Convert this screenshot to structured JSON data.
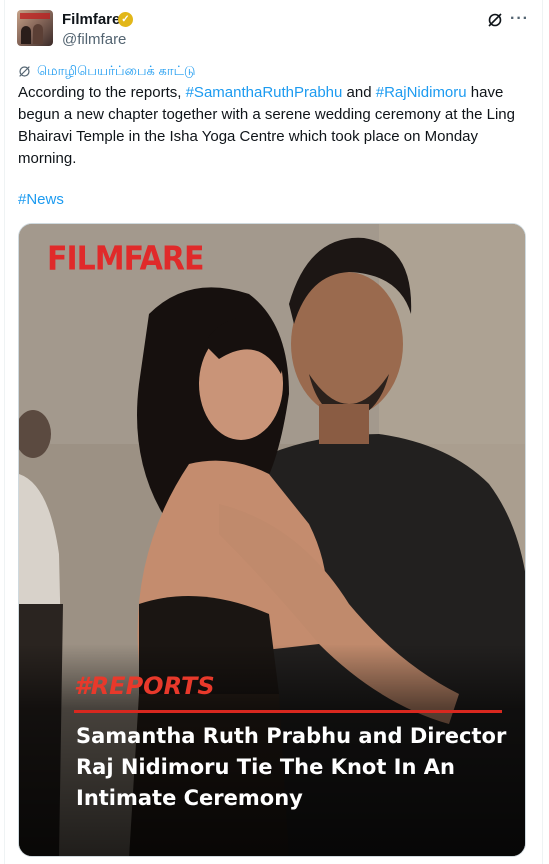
{
  "author": {
    "name": "Filmfare",
    "handle": "@filmfare",
    "verified_icon": "verified-badge-icon",
    "verified_color": "#e2b719"
  },
  "actions": {
    "grok_icon": "grok-icon",
    "more_label": "···"
  },
  "translate": {
    "label": "மொழிபெயர்ப்பைக் காட்டு",
    "icon": "translate-icon"
  },
  "tweet": {
    "prefix": "According to the reports, ",
    "mention1": "#SamanthaRuthPrabhu",
    "middle": " and ",
    "mention2": "#RajNidimoru",
    "rest": " have begun a new chapter together with a serene wedding ceremony at the Ling Bhairavi Temple in the Isha Yoga Centre which took place on Monday morning.",
    "hashtag": "#News"
  },
  "media": {
    "brand": "FILMFARE",
    "tagline": "#REPORTS",
    "headline": "Samantha Ruth Prabhu and Director Raj Nidimoru Tie The Knot In An Intimate Ceremony"
  },
  "colors": {
    "link": "#1d9bf0",
    "brand_red": "#e02a2a",
    "text": "#0f1419",
    "muted": "#536471"
  }
}
